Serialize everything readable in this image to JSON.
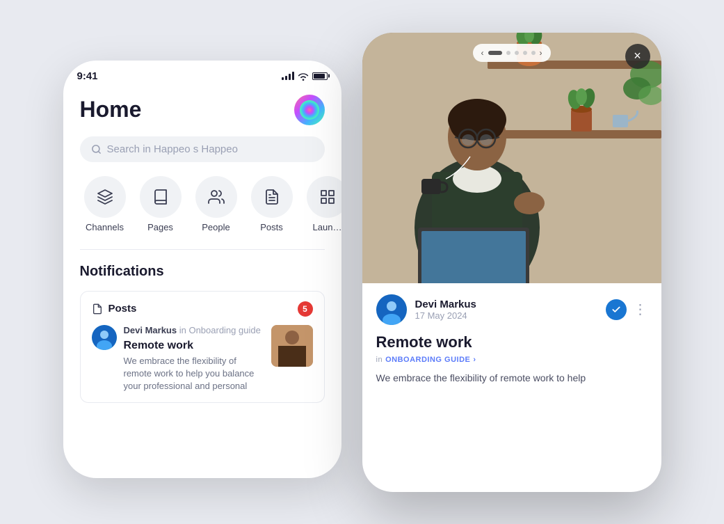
{
  "scene": {
    "background_color": "#e8eaf0"
  },
  "phone_back": {
    "status": {
      "time": "9:41",
      "signal": "●●●●",
      "wifi": "wifi",
      "battery": "battery"
    },
    "header": {
      "title": "Home",
      "avatar_emoji": "🌈"
    },
    "search": {
      "placeholder": "Search in Happeo s Happeo"
    },
    "quick_actions": [
      {
        "id": "channels",
        "label": "Channels",
        "icon": "layers"
      },
      {
        "id": "pages",
        "label": "Pages",
        "icon": "book-open"
      },
      {
        "id": "people",
        "label": "People",
        "icon": "users"
      },
      {
        "id": "posts",
        "label": "Posts",
        "icon": "file-text"
      },
      {
        "id": "launch",
        "label": "Laun…",
        "icon": "grid"
      }
    ],
    "notifications": {
      "section_title": "Notifications",
      "posts_card": {
        "label": "Posts",
        "count": "5",
        "author": "Devi Markus",
        "channel": "Onboarding guide",
        "post_title": "Remote work",
        "post_excerpt": "We embrace the flexibility of remote work to help you balance your professional and personal"
      }
    }
  },
  "phone_front": {
    "carousel": {
      "prev_label": "‹",
      "next_label": "›",
      "dots": [
        true,
        false,
        false,
        false,
        false
      ]
    },
    "close_label": "×",
    "post": {
      "author_name": "Devi Markus",
      "date": "17 May 2024",
      "title": "Remote work",
      "channel_prefix": "in",
      "channel": "ONBOARDING GUIDE",
      "channel_arrow": "›",
      "body": "We embrace the flexibility of remote work to help"
    }
  }
}
